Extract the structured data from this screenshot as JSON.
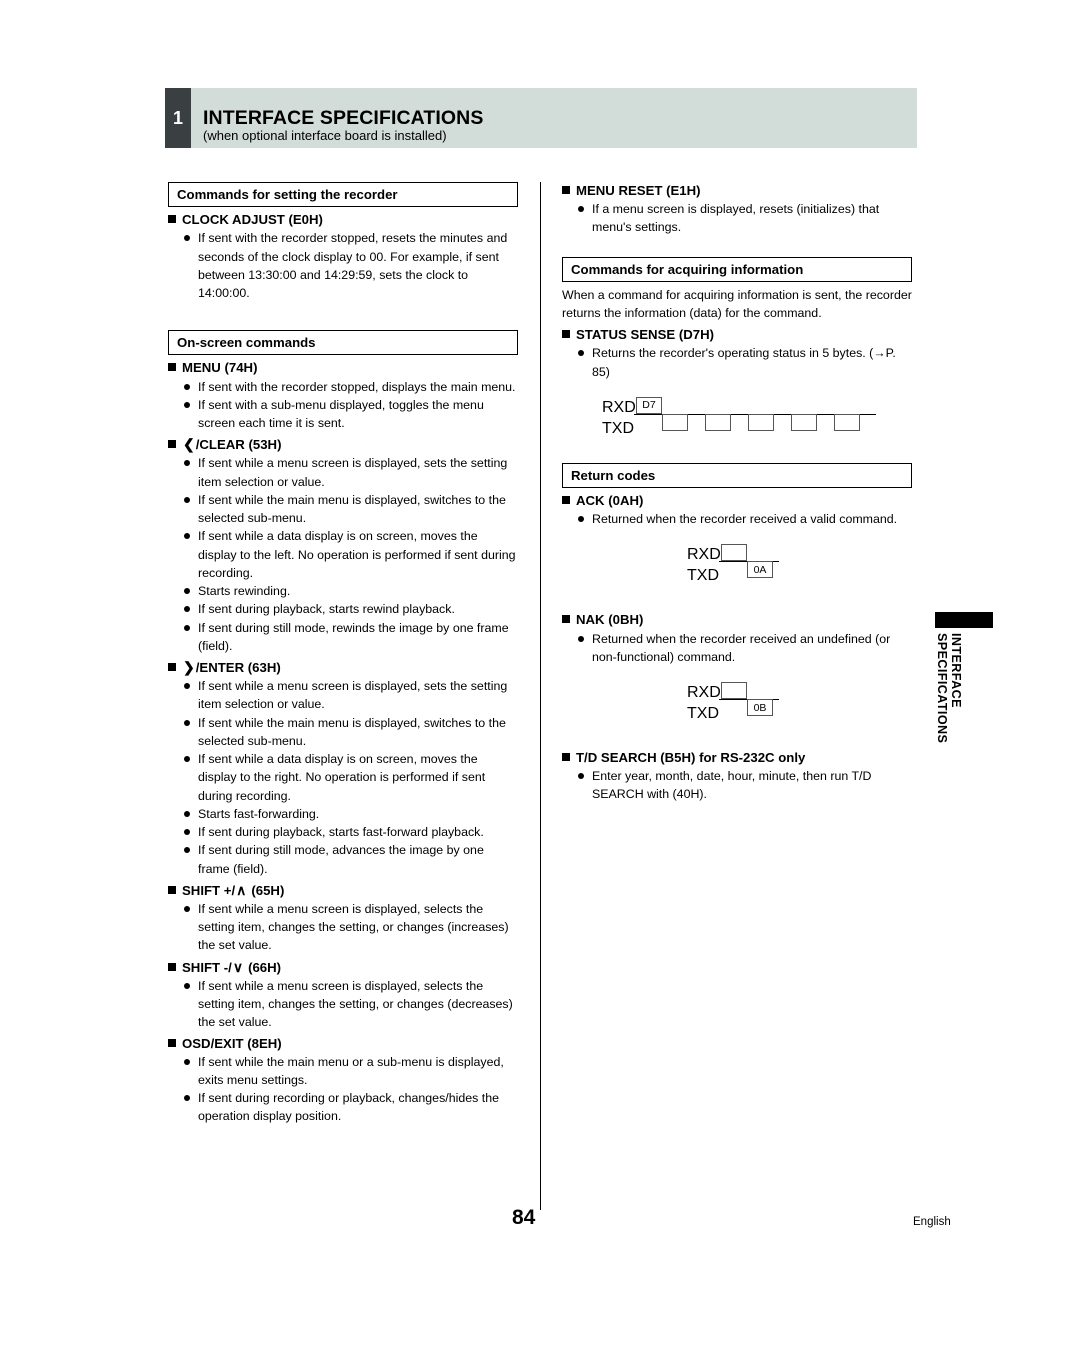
{
  "header": {
    "chapter_number": "1",
    "title": "INTERFACE SPECIFICATIONS",
    "subtitle": "(when optional interface board is installed)"
  },
  "left_column": {
    "section1": {
      "box_title": "Commands for setting the recorder",
      "commands": [
        {
          "name": "clock-adjust",
          "label": "CLOCK ADJUST (E0H)",
          "bullets": [
            "If sent with the recorder stopped, resets the minutes and seconds of the clock display to 00. For example, if sent between 13:30:00 and 14:29:59, sets the clock to 14:00:00."
          ]
        }
      ]
    },
    "section2": {
      "box_title": "On-screen commands",
      "commands": [
        {
          "name": "menu",
          "label": "MENU (74H)",
          "bullets": [
            "If sent with the recorder stopped, displays the main menu.",
            "If sent with a sub-menu displayed, toggles the menu screen each time it is sent."
          ]
        },
        {
          "name": "clear",
          "glyph": "❮",
          "label": "/CLEAR (53H)",
          "bullets": [
            "If sent while a menu screen is displayed, sets the setting item selection or value.",
            "If sent while the main menu is displayed, switches to the selected sub-menu.",
            "If sent while a data display is on screen, moves the display to the left. No operation is performed if sent during recording.",
            "Starts rewinding.",
            "If sent during playback, starts rewind playback.",
            "If sent during still mode, rewinds the image by one frame (field)."
          ]
        },
        {
          "name": "enter",
          "glyph": "❯",
          "label": "/ENTER (63H)",
          "bullets": [
            "If sent while a menu screen is displayed, sets the setting item selection or value.",
            "If sent while the main menu is displayed, switches to the selected sub-menu.",
            "If sent while a data display is on screen, moves the display to the right. No operation is performed if sent during recording.",
            "Starts fast-forwarding.",
            "If sent during playback, starts fast-forward playback.",
            "If sent during still mode, advances the image by one frame (field)."
          ]
        },
        {
          "name": "shift-plus",
          "label_pre": "SHIFT +/",
          "glyph": "∧",
          "label_post": "(65H)",
          "bullets": [
            "If sent while a menu screen is displayed, selects the setting item, changes the setting, or changes (increases) the set value."
          ]
        },
        {
          "name": "shift-minus",
          "label_pre": "SHIFT -/",
          "glyph": "∨",
          "label_post": "(66H)",
          "bullets": [
            "If sent while a menu screen is displayed, selects the setting item, changes the setting, or changes (decreases) the set value."
          ]
        },
        {
          "name": "osd-exit",
          "label": "OSD/EXIT (8EH)",
          "bullets": [
            "If sent while the main menu or a sub-menu is displayed, exits menu settings.",
            "If sent during recording or playback, changes/hides the operation display position."
          ]
        }
      ]
    }
  },
  "right_column": {
    "menu_reset": {
      "label": "MENU RESET (E1H)",
      "bullets": [
        "If a menu screen is displayed, resets (initializes) that menu's settings."
      ]
    },
    "section_acquiring": {
      "box_title": "Commands for acquiring information",
      "intro": "When a command for acquiring information is sent, the recorder returns the information (data) for the command.",
      "status_sense": {
        "label": "STATUS SENSE (D7H)",
        "bullets": [
          "Returns the recorder's operating status in 5 bytes. (→P. 85)"
        ],
        "diagram": {
          "rxd_label": "RXD",
          "txd_label": "TXD",
          "rxd_boxes": [
            "D7"
          ],
          "txd_boxes": [
            "",
            "",
            "",
            "",
            ""
          ]
        }
      }
    },
    "section_return_codes": {
      "box_title": "Return codes",
      "ack": {
        "label": "ACK (0AH)",
        "bullets": [
          "Returned when the recorder received a valid command."
        ],
        "diagram": {
          "rxd_label": "RXD",
          "txd_label": "TXD",
          "rxd_boxes": [
            ""
          ],
          "txd_boxes": [
            "0A"
          ]
        }
      },
      "nak": {
        "label": "NAK (0BH)",
        "bullets": [
          "Returned when the recorder received an undefined (or non-functional) command."
        ],
        "diagram": {
          "rxd_label": "RXD",
          "txd_label": "TXD",
          "rxd_boxes": [
            ""
          ],
          "txd_boxes": [
            "0B"
          ]
        }
      },
      "td_search": {
        "label": "T/D SEARCH (B5H) for RS-232C only",
        "bullets": [
          "Enter year, month, date, hour, minute, then run T/D SEARCH with (40H)."
        ]
      }
    }
  },
  "side_tab": {
    "line1": "INTERFACE",
    "line2": "SPECIFICATIONS"
  },
  "footer": {
    "page_number": "84",
    "language": "English"
  }
}
